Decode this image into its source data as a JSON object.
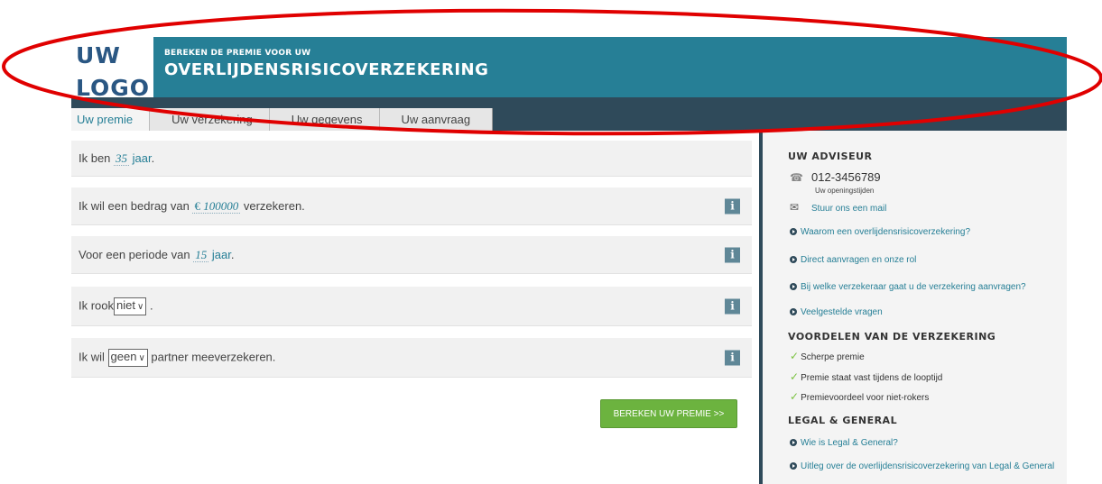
{
  "logo": {
    "line1": "UW",
    "line2": "LOGO"
  },
  "header": {
    "subtitle": "BEREKEN DE PREMIE VOOR UW",
    "title": "OVERLIJDENSRISICOVERZEKERING"
  },
  "steps": [
    {
      "label": "Uw premie"
    },
    {
      "label": "Uw verzekering"
    },
    {
      "label": "Uw gegevens"
    },
    {
      "label": "Uw aanvraag"
    }
  ],
  "form": {
    "age": {
      "prefix": "Ik ben",
      "value": "35",
      "unit": "jaar",
      "suffix": "."
    },
    "amount": {
      "prefix": "Ik wil een bedrag van",
      "currency": "€",
      "value": "100000",
      "suffix": "verzekeren."
    },
    "period": {
      "prefix": "Voor een periode van",
      "value": "15",
      "unit": "jaar",
      "suffix": "."
    },
    "smoke": {
      "prefix": "Ik rook",
      "selected": "niet",
      "suffix": "."
    },
    "partner": {
      "prefix": "Ik wil",
      "selected": "geen",
      "suffix": "partner meeverzekeren."
    },
    "info_label": "i",
    "calc_button": "BEREKEN UW PREMIE >>"
  },
  "sidebar": {
    "advisor_title": "UW ADVISEUR",
    "phone": "012-3456789",
    "hours": "Uw openingstijden",
    "mail": "Stuur ons een mail",
    "links": [
      "Waarom een overlijdensrisicoverzekering?",
      "Direct aanvragen en onze rol",
      "Bij welke verzekeraar gaat u de verzekering aanvragen?",
      "Veelgestelde vragen"
    ],
    "benefits_title": "VOORDELEN VAN DE VERZEKERING",
    "benefits": [
      "Scherpe premie",
      "Premie staat vast tijdens de looptijd",
      "Premievoordeel voor niet-rokers"
    ],
    "lg_title": "LEGAL & GENERAL",
    "lg_links": [
      "Wie is Legal & General?",
      "Uitleg over de overlijdensrisicoverzekering van Legal & General"
    ]
  },
  "colors": {
    "header": "#267f96",
    "nav": "#2f4a5a",
    "logo": "#2a5783",
    "button": "#6cb33f",
    "annotation": "#e00000"
  }
}
